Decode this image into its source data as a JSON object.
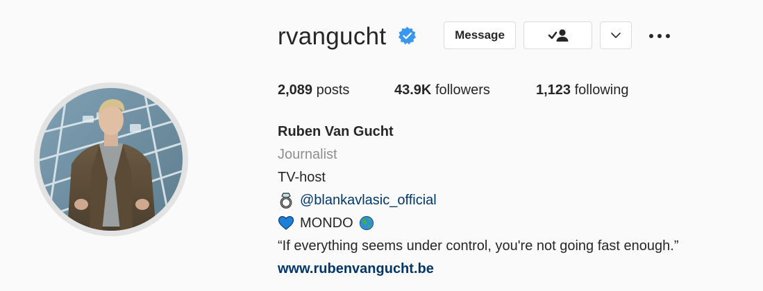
{
  "profile": {
    "username": "rvangucht",
    "verified": true,
    "full_name": "Ruben Van Gucht",
    "category": "Journalist",
    "bio_lines": [
      "TV-host",
      "@blankavlasic_official",
      "MONDO",
      "“If everything seems under control, you're not going fast enough.”"
    ],
    "website": "www.rubenvangucht.be"
  },
  "actions": {
    "message_label": "Message"
  },
  "stats": {
    "posts_value": "2,089",
    "posts_label": "posts",
    "followers_value": "43.9K",
    "followers_label": "followers",
    "following_value": "1,123",
    "following_label": "following"
  },
  "icons": {
    "verified": "verified-badge-icon",
    "follow": "following-check-person-icon",
    "chevron": "chevron-down-icon",
    "more": "more-options-icon",
    "ring": "ring-emoji-icon",
    "heart": "blue-heart-emoji-icon",
    "globe": "globe-emoji-icon"
  },
  "colors": {
    "background": "#fafafa",
    "text": "#262626",
    "secondary_text": "#8e8e8e",
    "link": "#00376b",
    "verified_blue": "#3897f0",
    "button_border": "#dbdbdb"
  }
}
